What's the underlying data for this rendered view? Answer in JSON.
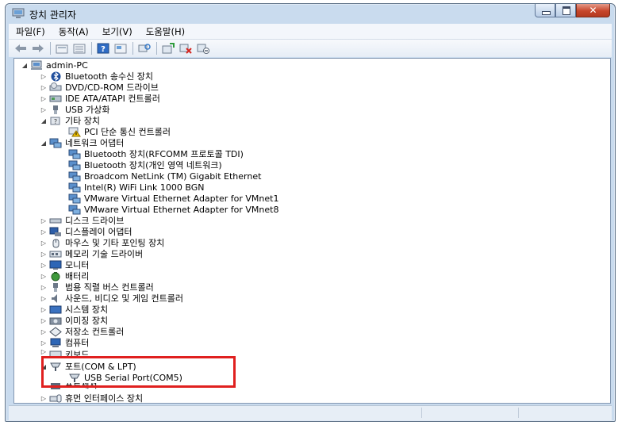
{
  "window": {
    "title": "장치 관리자"
  },
  "menu": [
    {
      "label": "파일(F)"
    },
    {
      "label": "동작(A)"
    },
    {
      "label": "보기(V)"
    },
    {
      "label": "도움말(H)"
    }
  ],
  "toolbar": {
    "buttons": [
      "back-icon",
      "forward-icon",
      "up-level-icon",
      "show-hide-icon",
      "help-icon",
      "properties-icon",
      "scan-hardware-icon",
      "update-driver-icon",
      "uninstall-icon",
      "disable-icon"
    ]
  },
  "tree": {
    "root": "admin-PC",
    "items": [
      {
        "label": "Bluetooth 송수신 장치",
        "icon": "bluetooth-icon"
      },
      {
        "label": "DVD/CD-ROM 드라이브",
        "icon": "dvd-drive-icon"
      },
      {
        "label": "IDE ATA/ATAPI 컨트롤러",
        "icon": "ide-controller-icon"
      },
      {
        "label": "USB 가상화",
        "icon": "usb-icon"
      },
      {
        "label": "기타 장치",
        "icon": "unknown-device-icon"
      },
      {
        "label": "PCI 단순 통신 컨트롤러",
        "icon": "warning-device-icon"
      },
      {
        "label": "네트워크 어댑터",
        "icon": "network-adapter-icon"
      },
      {
        "label": "Bluetooth 장치(RFCOMM 프로토콜 TDI)",
        "icon": "network-adapter-icon"
      },
      {
        "label": "Bluetooth 장치(개인 영역 네트워크)",
        "icon": "network-adapter-icon"
      },
      {
        "label": "Broadcom NetLink (TM) Gigabit Ethernet",
        "icon": "network-adapter-icon"
      },
      {
        "label": "Intel(R) WiFi Link 1000 BGN",
        "icon": "network-adapter-icon"
      },
      {
        "label": "VMware Virtual Ethernet Adapter for VMnet1",
        "icon": "network-adapter-icon"
      },
      {
        "label": "VMware Virtual Ethernet Adapter for VMnet8",
        "icon": "network-adapter-icon"
      },
      {
        "label": "디스크 드라이브",
        "icon": "disk-drive-icon"
      },
      {
        "label": "디스플레이 어댑터",
        "icon": "display-adapter-icon"
      },
      {
        "label": "마우스 및 기타 포인팅 장치",
        "icon": "mouse-icon"
      },
      {
        "label": "메모리 기술 드라이버",
        "icon": "memory-icon"
      },
      {
        "label": "모니터",
        "icon": "monitor-icon"
      },
      {
        "label": "배터리",
        "icon": "battery-icon"
      },
      {
        "label": "범용 직렬 버스 컨트롤러",
        "icon": "usb-controller-icon"
      },
      {
        "label": "사운드, 비디오 및 게임 컨트롤러",
        "icon": "sound-icon"
      },
      {
        "label": "시스템 장치",
        "icon": "system-device-icon"
      },
      {
        "label": "이미징 장치",
        "icon": "imaging-icon"
      },
      {
        "label": "저장소 컨트롤러",
        "icon": "storage-controller-icon"
      },
      {
        "label": "컴퓨터",
        "icon": "computer-icon"
      },
      {
        "label": "키보드",
        "icon": "keyboard-icon"
      },
      {
        "label": "포트(COM & LPT)",
        "icon": "port-icon"
      },
      {
        "label": "USB Serial Port(COM5)",
        "icon": "port-icon"
      },
      {
        "label": "프로세서",
        "icon": "processor-icon"
      },
      {
        "label": "휴먼 인터페이스 장치",
        "icon": "hid-icon"
      }
    ]
  },
  "colors": {
    "highlight_box": "#e0201f",
    "frame": "#c9dbee",
    "close_button": "#c7462b"
  }
}
